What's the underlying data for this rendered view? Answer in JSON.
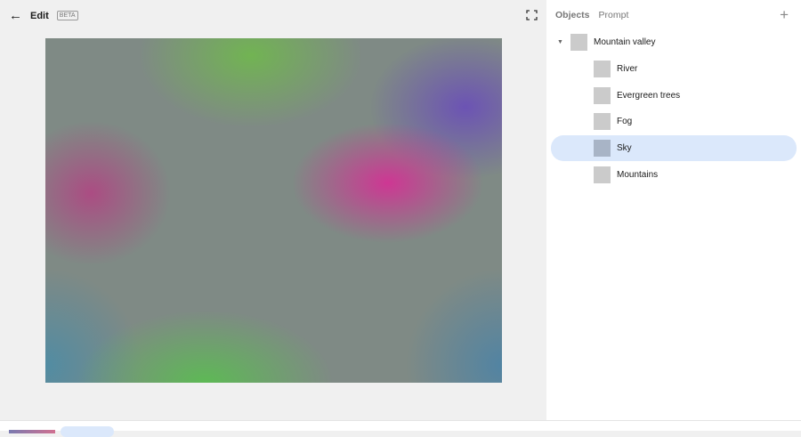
{
  "header": {
    "title": "Edit",
    "badge": "BETA"
  },
  "panel": {
    "tabs": [
      "Objects",
      "Prompt"
    ],
    "root": "Mountain valley",
    "items": [
      "River",
      "Evergreen trees",
      "Fog",
      "Sky",
      "Mountains"
    ],
    "selected": "Sky"
  }
}
